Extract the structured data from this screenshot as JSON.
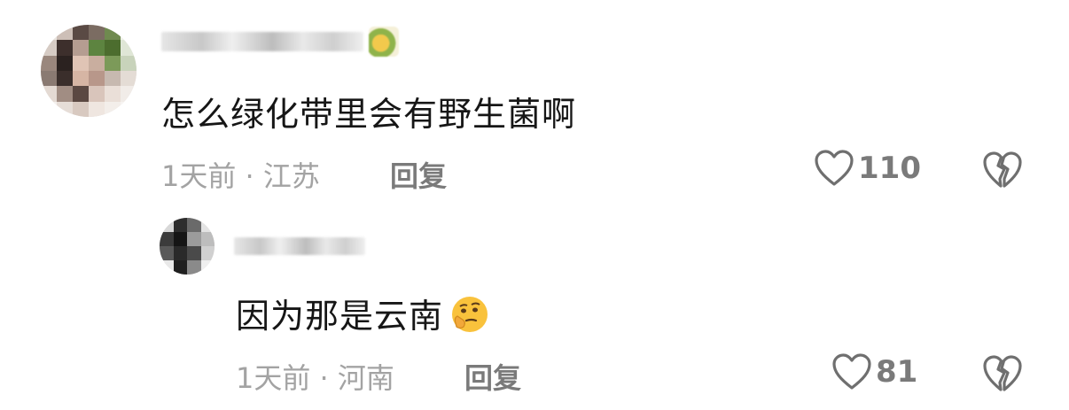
{
  "comments": [
    {
      "text": "怎么绿化带里会有野生菌啊",
      "time": "1天前",
      "separator": "·",
      "location": "江苏",
      "reply_label": "回复",
      "like_count": "110"
    },
    {
      "text": "因为那是云南",
      "emoji": "thinking-face-emoji",
      "time": "1天前",
      "separator": "·",
      "location": "河南",
      "reply_label": "回复",
      "like_count": "81"
    }
  ],
  "icons": {
    "like": "heart-outline-icon",
    "dislike": "broken-heart-icon"
  },
  "colors": {
    "text": "#161616",
    "meta": "#a3a3a3",
    "action": "#7a7a7a",
    "icon": "#6f6f6f"
  }
}
